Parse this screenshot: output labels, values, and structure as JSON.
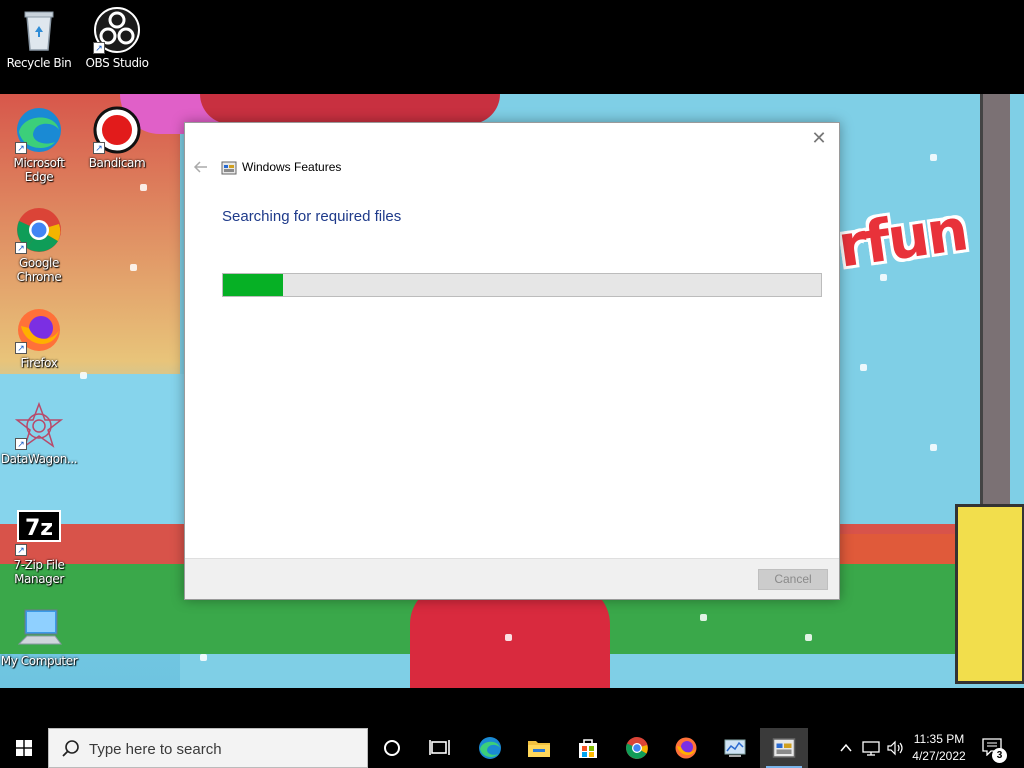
{
  "desktop": {
    "icons": [
      {
        "label": "Recycle Bin",
        "icon": "recycle-bin-icon"
      },
      {
        "label": "OBS Studio",
        "icon": "obs-studio-icon"
      },
      {
        "label": "Microsoft Edge",
        "icon": "edge-icon"
      },
      {
        "label": "Bandicam",
        "icon": "bandicam-icon"
      },
      {
        "label": "Google Chrome",
        "icon": "chrome-icon"
      },
      {
        "label": "Firefox",
        "icon": "firefox-icon"
      },
      {
        "label": "DataWagon...",
        "icon": "datawagon-icon"
      },
      {
        "label": "7-Zip File Manager",
        "icon": "7zip-icon"
      },
      {
        "label": "My Computer",
        "icon": "computer-icon"
      }
    ],
    "wallpaper_text": "rfun"
  },
  "dialog": {
    "title": "Windows Features",
    "close_label": "✕",
    "status": "Searching for required files",
    "progress": 0.1,
    "cancel_label": "Cancel",
    "cancel_enabled": false,
    "progress_color": "#06b025",
    "heading_color": "#1e3a8a"
  },
  "taskbar": {
    "search_placeholder": "Type here to search",
    "pinned": [
      "cortana-icon",
      "task-view-icon",
      "edge-icon",
      "file-explorer-icon",
      "microsoft-store-icon",
      "chrome-icon",
      "firefox-icon",
      "control-panel-icon",
      "windows-features-icon"
    ],
    "tray": {
      "chevron": "^",
      "time": "11:35 PM",
      "date": "4/27/2022",
      "notification_count": "3"
    }
  }
}
